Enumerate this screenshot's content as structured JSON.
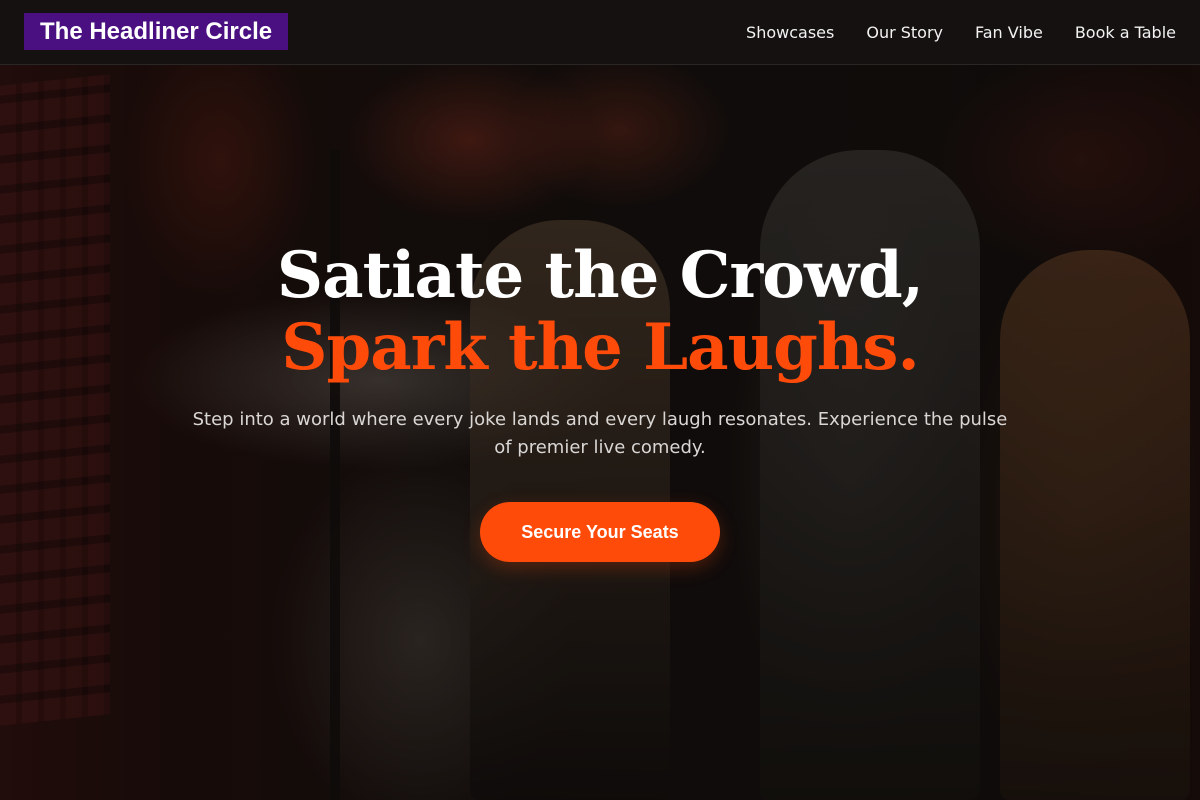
{
  "brand": {
    "name": "The Headliner Circle"
  },
  "nav": {
    "links": [
      "Showcases",
      "Our Story",
      "Fan Vibe",
      "Book a Table"
    ]
  },
  "hero": {
    "headline_line1": "Satiate the Crowd,",
    "headline_line2": "Spark the Laughs.",
    "subtext": "Step into a world where every joke lands and every laugh resonates. Experience the pulse of premier live comedy.",
    "cta_label": "Secure Your Seats"
  },
  "colors": {
    "accent": "#ff4b0a",
    "brand_bg": "#4a0f80",
    "navbar_bg": "#141110"
  }
}
